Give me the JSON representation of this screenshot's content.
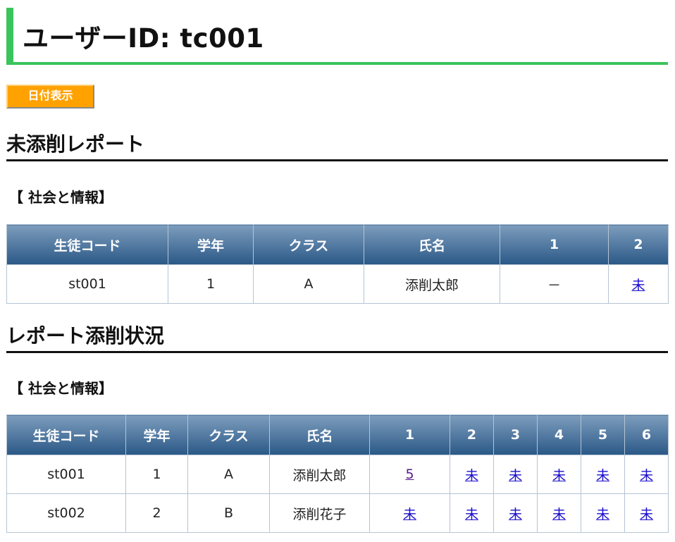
{
  "page_title": "ユーザーID: tc001",
  "date_button_label": "日付表示",
  "unmarked": {
    "heading": "未添削レポート",
    "subject": "【 社会と情報】",
    "columns": [
      "生徒コード",
      "学年",
      "クラス",
      "氏名",
      "1",
      "2"
    ],
    "rows": [
      {
        "code": "st001",
        "grade": "1",
        "class": "A",
        "name": "添削太郎",
        "r1": "－",
        "r2": "未"
      }
    ]
  },
  "status": {
    "heading": "レポート添削状況",
    "subject": "【 社会と情報】",
    "columns": [
      "生徒コード",
      "学年",
      "クラス",
      "氏名",
      "1",
      "2",
      "3",
      "4",
      "5",
      "6"
    ],
    "rows": [
      {
        "code": "st001",
        "grade": "1",
        "class": "A",
        "name": "添削太郎",
        "r1": "5",
        "r2": "未",
        "r3": "未",
        "r4": "未",
        "r5": "未",
        "r6": "未"
      },
      {
        "code": "st002",
        "grade": "2",
        "class": "B",
        "name": "添削花子",
        "r1": "未",
        "r2": "未",
        "r3": "未",
        "r4": "未",
        "r5": "未",
        "r6": "未"
      }
    ]
  },
  "colors": {
    "accent_green": "#3ac45c",
    "button_orange": "#ffa200",
    "header_blue": "#2a5886",
    "link_blue": "#1a0dcc",
    "link_visited": "#551a8b"
  }
}
